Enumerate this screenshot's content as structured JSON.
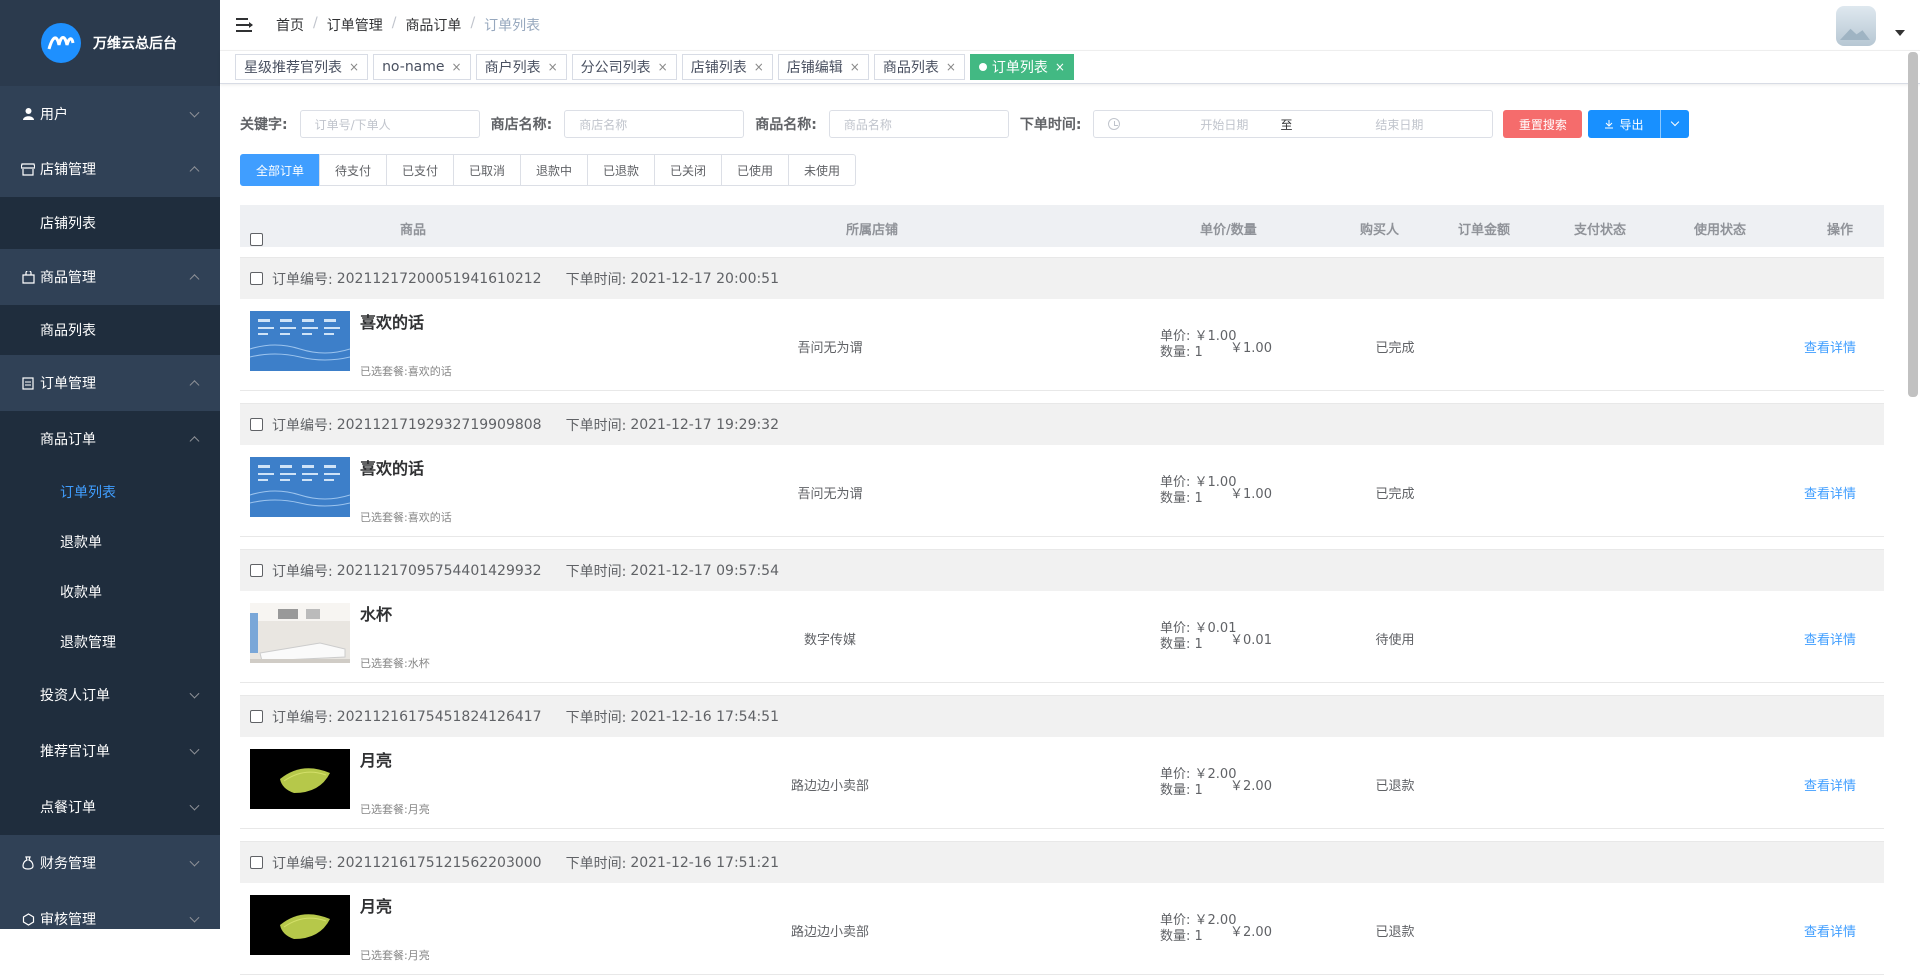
{
  "brand": {
    "name": "万维云总后台"
  },
  "sidebar": {
    "user": "用户",
    "shop_mgmt": "店铺管理",
    "shop_list": "店铺列表",
    "goods_mgmt": "商品管理",
    "goods_list": "商品列表",
    "order_mgmt": "订单管理",
    "goods_order": "商品订单",
    "order_list": "订单列表",
    "refund_order": "退款单",
    "receipt": "收款单",
    "refund_mgmt": "退款管理",
    "investor_order": "投资人订单",
    "recommender_order": "推荐官订单",
    "dining_order": "点餐订单",
    "finance_mgmt": "财务管理",
    "audit_mgmt": "审核管理"
  },
  "breadcrumb": [
    "首页",
    "订单管理",
    "商品订单",
    "订单列表"
  ],
  "tags": [
    {
      "label": "星级推荐官列表",
      "x": "×"
    },
    {
      "label": "no-name",
      "x": "×"
    },
    {
      "label": "商户列表",
      "x": "×"
    },
    {
      "label": "分公司列表",
      "x": "×"
    },
    {
      "label": "店铺列表",
      "x": "×"
    },
    {
      "label": "店铺编辑",
      "x": "×"
    },
    {
      "label": "商品列表",
      "x": "×"
    },
    {
      "label": "订单列表",
      "x": "×"
    }
  ],
  "filters": {
    "keyword_label": "关键字:",
    "keyword_placeholder": "订单号/下单人",
    "store_label": "商店名称:",
    "store_placeholder": "商店名称",
    "goods_label": "商品名称:",
    "goods_placeholder": "商品名称",
    "time_label": "下单时间:",
    "start_placeholder": "开始日期",
    "range_sep": "至",
    "end_placeholder": "结束日期",
    "reset_button": "重置搜索",
    "export_button": "导出"
  },
  "status_tabs": [
    "全部订单",
    "待支付",
    "已支付",
    "已取消",
    "退款中",
    "已退款",
    "已关闭",
    "已使用",
    "未使用"
  ],
  "table_headers": {
    "goods": "商品",
    "store": "所属店铺",
    "price_qty": "单价/数量",
    "buyer": "购买人",
    "amount": "订单金额",
    "pay_status": "支付状态",
    "use_status": "使用状态",
    "action": "操作"
  },
  "order_no_label": "订单编号:",
  "order_time_label": "下单时间:",
  "selected_label": "已选套餐:",
  "unit_price_label": "单价:",
  "qty_label": "数量:",
  "detail_link": "查看详情",
  "orders": [
    {
      "no": "20211217200051941610212",
      "time": "2021-12-17 20:00:51",
      "product": "喜欢的话",
      "package": "喜欢的话",
      "store": "吾问无为谓",
      "price": "￥1.00",
      "qty": "1",
      "amount": "￥1.00",
      "pay_status": "已完成",
      "thumb": "blue-grid"
    },
    {
      "no": "20211217192932719909808",
      "time": "2021-12-17 19:29:32",
      "product": "喜欢的话",
      "package": "喜欢的话",
      "store": "吾问无为谓",
      "price": "￥1.00",
      "qty": "1",
      "amount": "￥1.00",
      "pay_status": "已完成",
      "thumb": "blue-grid"
    },
    {
      "no": "20211217095754401429932",
      "time": "2021-12-17 09:57:54",
      "product": "水杯",
      "package": "水杯",
      "store": "数字传媒",
      "price": "￥0.01",
      "qty": "1",
      "amount": "￥0.01",
      "pay_status": "待使用",
      "thumb": "office"
    },
    {
      "no": "20211216175451824126417",
      "time": "2021-12-16 17:54:51",
      "product": "月亮",
      "package": "月亮",
      "store": "路边边小卖部",
      "price": "￥2.00",
      "qty": "1",
      "amount": "￥2.00",
      "pay_status": "已退款",
      "thumb": "moon"
    },
    {
      "no": "20211216175121562203000",
      "time": "2021-12-16 17:51:21",
      "product": "月亮",
      "package": "月亮",
      "store": "路边边小卖部",
      "price": "￥2.00",
      "qty": "1",
      "amount": "￥2.00",
      "pay_status": "已退款",
      "thumb": "moon"
    }
  ]
}
